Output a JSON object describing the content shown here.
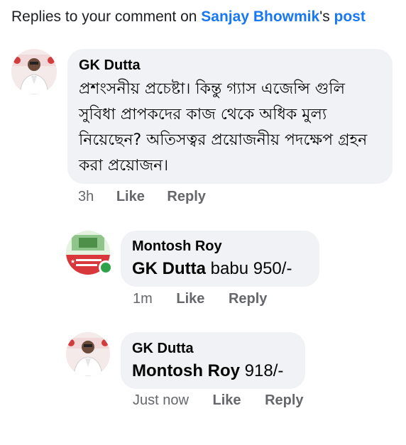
{
  "header": {
    "prefix": "Replies to your comment on ",
    "author_link": "Sanjay Bhowmik",
    "possessive": "'s ",
    "post_link": "post"
  },
  "comments": [
    {
      "author": "GK Dutta",
      "text": "প্রশংসনীয় প্রচেষ্টা। কিন্তু গ্যাস এজেন্সি গুলি সুবিধা প্রাপকদের কাজ থেকে অধিক মুল্য নিয়েছেন? অতিসত্বর প্রয়োজনীয় পদক্ষেপ গ্রহন করা প্রয়োজন।",
      "time": "3h",
      "like": "Like",
      "reply": "Reply"
    },
    {
      "author": "Montosh Roy",
      "mention": "GK Dutta",
      "text": "babu 950/-",
      "time": "1m",
      "like": "Like",
      "reply": "Reply"
    },
    {
      "author": "GK Dutta",
      "mention": "Montosh Roy",
      "text": "918/-",
      "time": "Just now",
      "like": "Like",
      "reply": "Reply"
    }
  ],
  "colors": {
    "link": "#1877f2",
    "bubble": "#f0f2f5",
    "meta": "#65676b",
    "online": "#31a24c"
  }
}
